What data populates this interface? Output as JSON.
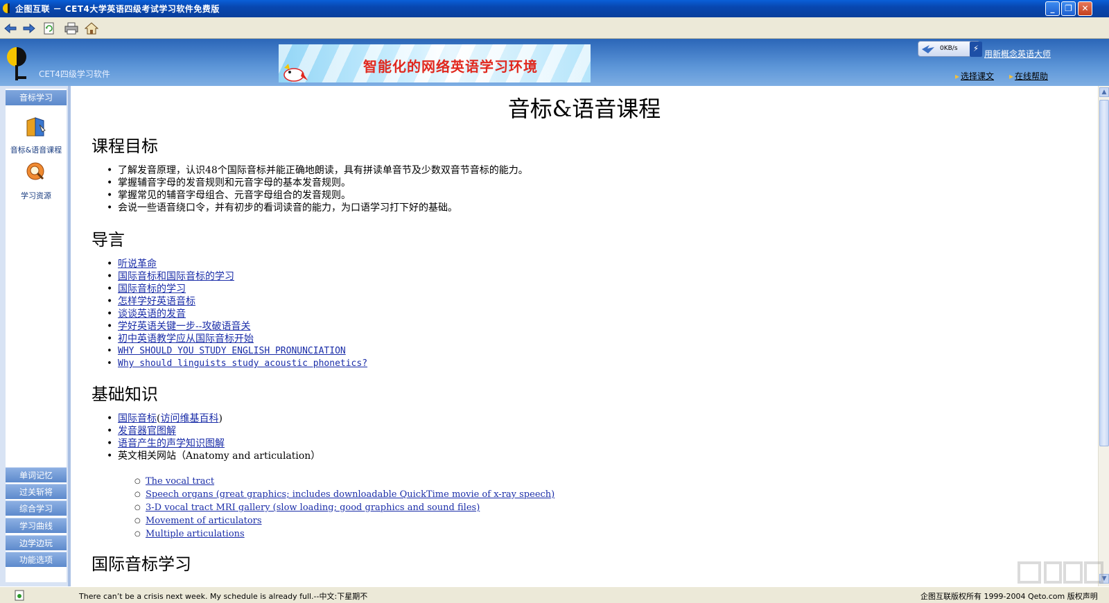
{
  "window": {
    "title": "企图互联 － CET4大学英语四级考试学习软件免费版",
    "minimize": "_",
    "maximize": "❐",
    "close": "✕"
  },
  "header": {
    "brand": "CET4四级学习软件",
    "ad_text": "智能化的网络英语学习环境",
    "speed": "0KB/s",
    "promo": "用新概念英语大师",
    "link_select": "选择课文",
    "link_help": "在线帮助"
  },
  "sidebar": {
    "top_label": "音标学习",
    "icons": [
      {
        "label": "音标&语音课程",
        "icon": "book-icon"
      },
      {
        "label": "学习资源",
        "icon": "magnifier-icon"
      }
    ],
    "buttons": [
      "单词记忆",
      "过关斩将",
      "综合学习",
      "学习曲线",
      "边学边玩",
      "功能选项"
    ]
  },
  "content": {
    "title": "音标&语音课程",
    "sections": {
      "goals": {
        "heading": "课程目标",
        "items": [
          "了解发音原理，认识48个国际音标并能正确地朗读，具有拼读单音节及少数双音节音标的能力。",
          "掌握辅音字母的发音规则和元音字母的基本发音规则。",
          "掌握常见的辅音字母组合、元音字母组合的发音规则。",
          "会说一些语音绕口令，并有初步的看词读音的能力，为口语学习打下好的基础。"
        ]
      },
      "intro": {
        "heading": "导言",
        "links": [
          "听说革命",
          "国际音标和国际音标的学习",
          "国际音标的学习",
          "怎样学好英语音标",
          "谈谈英语的发音",
          "学好英语关键一步--攻破语音关",
          "初中英语教学应从国际音标开始",
          "WHY SHOULD YOU STUDY ENGLISH PRONUNCIATION",
          "Why should linguists study acoustic phonetics?"
        ]
      },
      "basics": {
        "heading": "基础知识",
        "item1_link": "国际音标",
        "item1_paren_open": "(",
        "item1_sublink": "访问维基百科",
        "item1_paren_close": ")",
        "item2": "发音器官图解",
        "item3": "语音产生的声学知识图解",
        "item4": "英文相关网站（Anatomy and articulation）",
        "sublinks": [
          "The vocal tract",
          "Speech organs (great graphics; includes downloadable QuickTime movie of x-ray speech)",
          "3-D vocal tract MRI gallery (slow loading; good graphics and sound files)",
          "Movement of articulators",
          "Multiple articulations"
        ]
      },
      "ipa": {
        "heading": "国际音标学习"
      }
    }
  },
  "status": {
    "marquee": "There can’t be a crisis next week. My schedule is already full.--中文:下星期不",
    "copyright": "企图互联版权所有  1999-2004 Qeto.com 版权声明"
  },
  "colors": {
    "link": "#1a2da8",
    "sidebar_button": "#5d8acc",
    "ad_text": "#e0281e"
  }
}
